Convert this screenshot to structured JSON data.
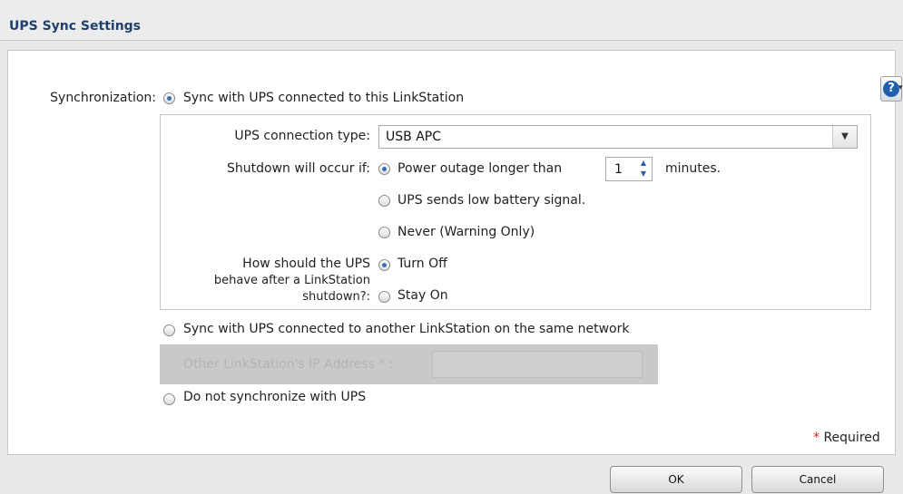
{
  "window": {
    "title": "UPS Sync Settings"
  },
  "help": {
    "glyph": "?",
    "caret": "▾",
    "icon": "help-icon"
  },
  "sync": {
    "label": "Synchronization:",
    "option_this": "Sync with UPS connected to this LinkStation",
    "option_other": "Sync with UPS connected to another LinkStation on the same network",
    "option_none": "Do not synchronize with UPS",
    "selected": "this"
  },
  "ups": {
    "connection_label": "UPS connection type:",
    "connection_value": "USB APC",
    "shutdown_label": "Shutdown will occur if:",
    "shutdown_options": {
      "outage": "Power outage longer than",
      "low_battery": "UPS sends low battery signal.",
      "never": "Never (Warning Only)"
    },
    "shutdown_selected": "outage",
    "minutes_value": "1",
    "minutes_unit": "minutes.",
    "behave_label_1": "How should the UPS",
    "behave_label_2": "behave after a LinkStation",
    "behave_label_3": "shutdown?:",
    "behave_options": {
      "off": "Turn Off",
      "on": "Stay On"
    },
    "behave_selected": "off"
  },
  "other": {
    "ip_label": "Other LinkStation's IP Address * :",
    "ip_value": ""
  },
  "required": {
    "star": "*",
    "text": "Required"
  },
  "buttons": {
    "ok": "OK",
    "cancel": "Cancel"
  }
}
